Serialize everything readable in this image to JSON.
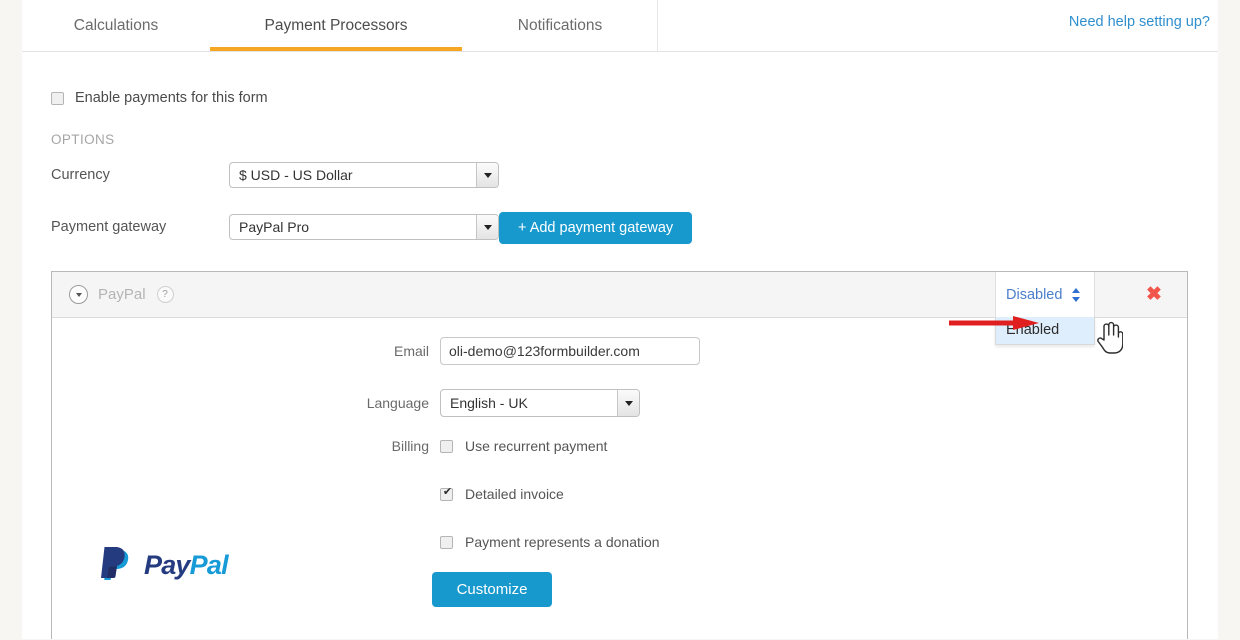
{
  "tabs": [
    {
      "label": "Calculations",
      "active": false
    },
    {
      "label": "Payment Processors",
      "active": true
    },
    {
      "label": "Notifications",
      "active": false
    }
  ],
  "header": {
    "help_link": "Need help setting up?",
    "accent_color": "#f5a623",
    "link_color": "#2f8fce"
  },
  "form": {
    "enable_payments_label": "Enable payments for this form",
    "enable_payments_checked": false,
    "options_title": "OPTIONS",
    "currency_label": "Currency",
    "currency_value": "$ USD - US Dollar",
    "gateway_label": "Payment gateway",
    "gateway_value": "PayPal Pro",
    "add_gateway_button": "+ Add payment gateway"
  },
  "panel": {
    "title": "PayPal",
    "help_icon_label": "?",
    "status_value": "Disabled",
    "status_options": [
      "Enabled"
    ],
    "status_highlighted": "Enabled",
    "delete_label": "✖",
    "logo_text_dark": "Pay",
    "logo_text_light": "Pal",
    "fields": {
      "email_label": "Email",
      "email_value": "oli-demo@123formbuilder.com",
      "language_label": "Language",
      "language_value": "English - UK",
      "billing_label": "Billing",
      "billing_options": [
        {
          "label": "Use recurrent payment",
          "checked": false
        },
        {
          "label": "Detailed invoice",
          "checked": true
        },
        {
          "label": "Payment represents a donation",
          "checked": false
        }
      ]
    },
    "customize_button": "Customize"
  },
  "colors": {
    "button_blue": "#1799ce",
    "status_blue": "#4a7ecb",
    "highlight_blue": "#dfeefc",
    "delete_red": "#f1554c",
    "annotation_red": "#e02020",
    "page_bg": "#f7f6f2"
  }
}
